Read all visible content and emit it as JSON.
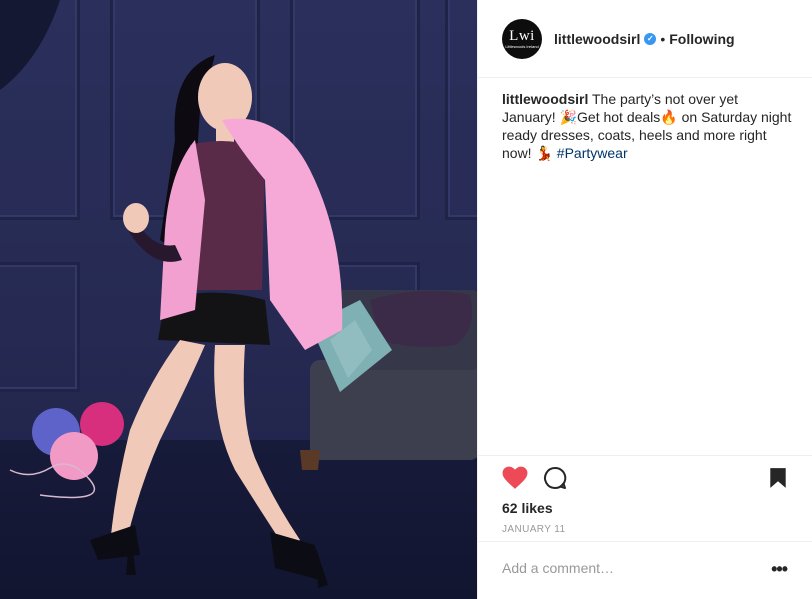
{
  "post": {
    "username": "littlewoodsirl",
    "following_label": "Following",
    "caption_author": "littlewoodsirl",
    "caption_text": " The party’s not over yet January! 🎉Get hot deals🔥 on Saturday night ready dresses, coats, heels and more right now! 💃",
    "caption_hashtag": "#Partywear",
    "likes": "62 likes",
    "date": "JANUARY 11",
    "comment_placeholder": "Add a comment…",
    "more_label": "•••",
    "avatar_text": "Lwi",
    "avatar_subtext": "Littlewoods Ireland"
  },
  "icons": {
    "verified": "verified-badge-icon",
    "like": "heart-icon",
    "comment": "comment-icon",
    "save": "bookmark-icon",
    "more": "more-options-icon"
  },
  "colors": {
    "like_red": "#ed4956",
    "verified_blue": "#3897f0",
    "hashtag_blue": "#003569",
    "photo_background": "#262a52",
    "coat_pink": "#f6a8d6"
  }
}
